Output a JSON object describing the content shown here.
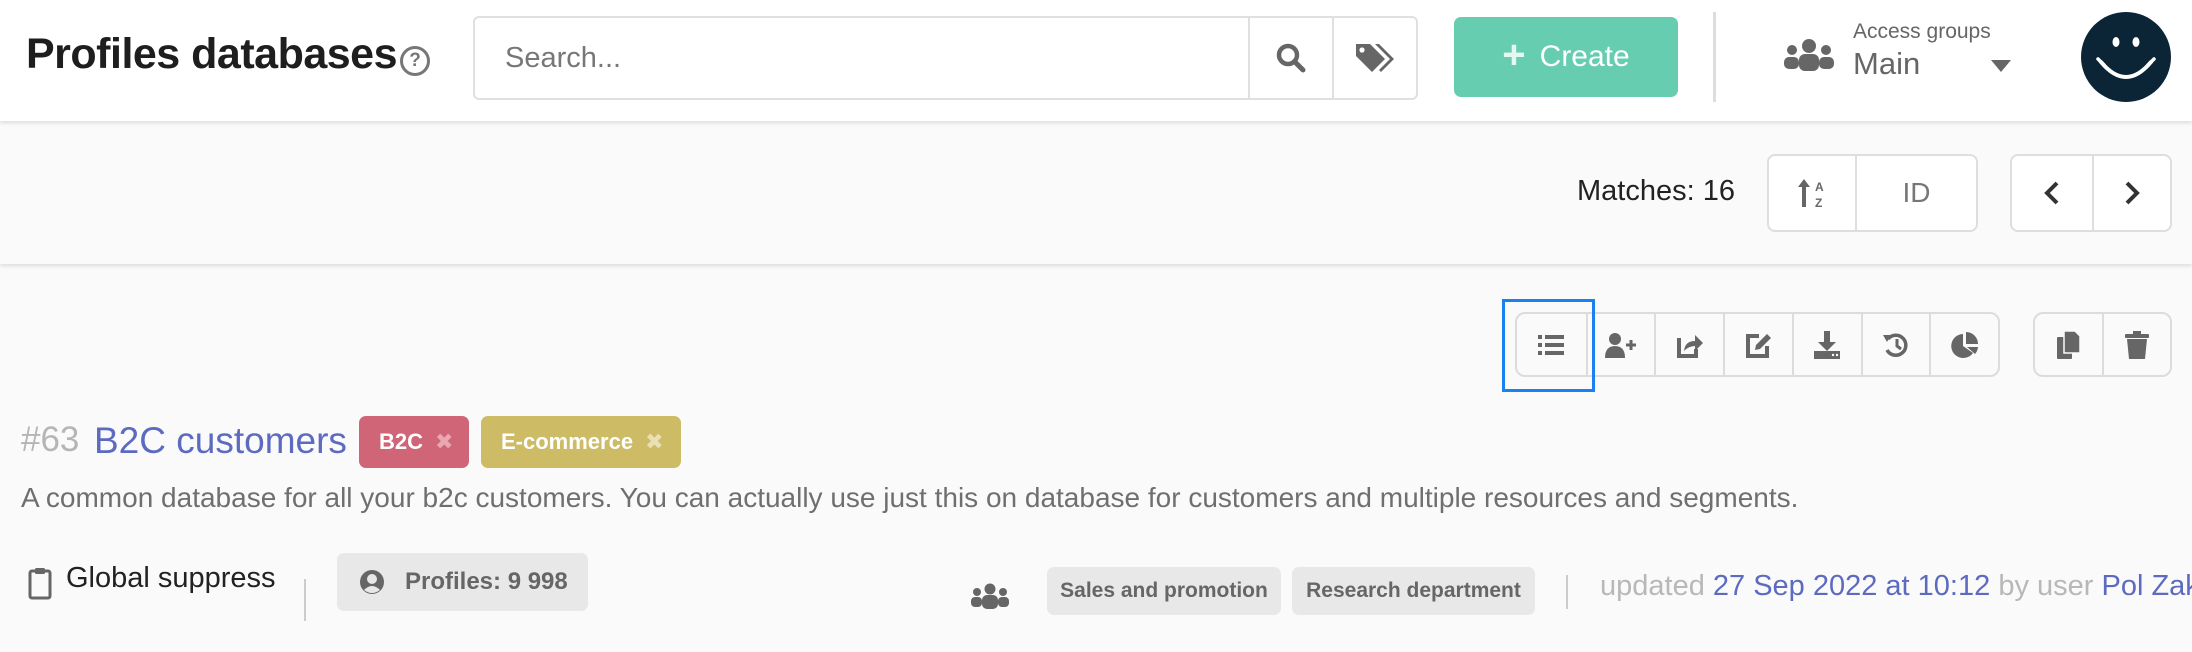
{
  "header": {
    "title": "Profiles databases",
    "help_icon": "question-circle-icon",
    "search": {
      "placeholder": "Search...",
      "value": ""
    },
    "search_button_icon": "search-icon",
    "tags_button_icon": "tags-icon",
    "create_label": "Create",
    "create_icon": "plus-icon",
    "access_groups": {
      "label": "Access groups",
      "value": "Main",
      "icon": "users-icon"
    },
    "avatar_icon": "smiley-icon"
  },
  "colors": {
    "accent_green": "#66cdb0",
    "link_blue": "#5c6bc0",
    "focus_blue": "#1a82f0",
    "avatar_bg": "#0b2436",
    "tag_b2c": "#cf6577",
    "tag_ecommerce": "#cdbb66"
  },
  "toolbar": {
    "matches_label": "Matches: 16",
    "sort": {
      "icon": "sort-alpha-icon",
      "field": "ID"
    },
    "nav": {
      "prev_icon": "chevron-left-icon",
      "next_icon": "chevron-right-icon"
    }
  },
  "card": {
    "actions": [
      {
        "name": "list",
        "icon": "list-icon"
      },
      {
        "name": "add-profile",
        "icon": "user-plus-icon"
      },
      {
        "name": "share",
        "icon": "share-icon"
      },
      {
        "name": "edit",
        "icon": "edit-icon"
      },
      {
        "name": "download",
        "icon": "download-icon"
      },
      {
        "name": "history",
        "icon": "history-icon"
      },
      {
        "name": "stats",
        "icon": "pie-chart-icon"
      }
    ],
    "actions2": [
      {
        "name": "copy",
        "icon": "copy-icon"
      },
      {
        "name": "delete",
        "icon": "trash-icon"
      }
    ],
    "id": "#63",
    "name": "B2C customers",
    "tags": [
      {
        "label": "B2C",
        "remove": "✖"
      },
      {
        "label": "E-commerce",
        "remove": "✖"
      }
    ],
    "description": "A common database for all your b2c customers. You can actually use just this on database for customers and multiple resources and segments.",
    "global_suppress": "Global suppress",
    "profiles": "Profiles: 9 998",
    "groups": [
      "Sales and promotion",
      "Research department"
    ],
    "updated": {
      "prefix": "updated",
      "date": "27 Sep 2022 at 10:12",
      "by": "by user",
      "user": "Pol Zak"
    }
  }
}
